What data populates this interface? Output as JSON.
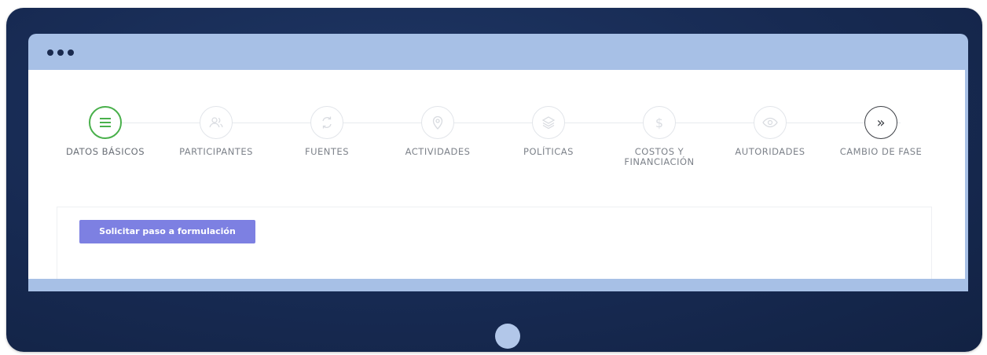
{
  "stepper": {
    "steps": [
      {
        "label": "DATOS BÁSICOS",
        "icon": "list-icon",
        "glyph": "≡"
      },
      {
        "label": "PARTICIPANTES",
        "icon": "users-icon",
        "glyph": ""
      },
      {
        "label": "FUENTES",
        "icon": "refresh-icon",
        "glyph": ""
      },
      {
        "label": "ACTIVIDADES",
        "icon": "location-pin-icon",
        "glyph": ""
      },
      {
        "label": "POLÍTICAS",
        "icon": "layers-icon",
        "glyph": ""
      },
      {
        "label": "COSTOS Y",
        "label2": "FINANCIACIÓN",
        "icon": "dollar-icon",
        "glyph": "$"
      },
      {
        "label": "AUTORIDADES",
        "icon": "eye-icon",
        "glyph": ""
      },
      {
        "label": "CAMBIO DE FASE",
        "icon": "double-chevron-right-icon",
        "glyph": "»"
      }
    ]
  },
  "actions": {
    "request_button": "Solicitar paso a formulación"
  },
  "colors": {
    "active": "#49b04b",
    "button": "#7d80e2",
    "frame": "#172a52",
    "chrome": "#a7c0e6"
  }
}
